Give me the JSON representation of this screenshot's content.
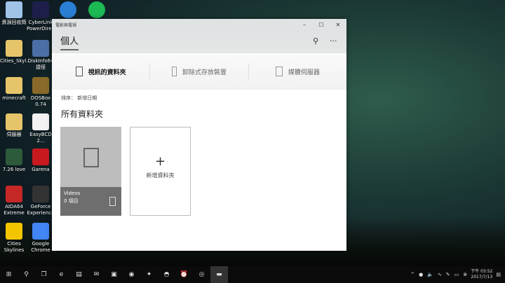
{
  "desktop": {
    "icons": [
      {
        "label": "資源回收筒",
        "color": "#9fc4e8"
      },
      {
        "label": "CyberLink PowerDire...",
        "color": "#1d1f4a"
      },
      {
        "label": "",
        "color": "#2a7fd4"
      },
      {
        "label": "",
        "color": "#1db954"
      },
      {
        "label": "Cities_Skyl...",
        "color": "#e6c56a"
      },
      {
        "label": "DiskInfo64 捷徑",
        "color": "#4d6fa8"
      },
      {
        "label": "minecraft",
        "color": "#e6c56a"
      },
      {
        "label": "DOSBox 0.74",
        "color": "#8a6a2a"
      },
      {
        "label": "伺服器",
        "color": "#e6c56a"
      },
      {
        "label": "EasyBCD 2...",
        "color": "#f2f2f2"
      },
      {
        "label": "7.26 love",
        "color": "#2c5a3a"
      },
      {
        "label": "Garena",
        "color": "#c8191f"
      },
      {
        "label": "AIDA64 Extreme",
        "color": "#c62828"
      },
      {
        "label": "GeForce Experience",
        "color": "#333333"
      },
      {
        "label": "Cities Skylines",
        "color": "#f2c500"
      },
      {
        "label": "Google Chrome",
        "color": "#4285f4"
      }
    ]
  },
  "window": {
    "title": "電影與電視",
    "controls": {
      "minimize": "–",
      "maximize": "☐",
      "close": "✕"
    },
    "tab": "個人",
    "search_icon": "⚲",
    "more_icon": "···",
    "pivots": [
      "視訊的資料夾",
      "卸除式存放裝置",
      "媒體伺服器"
    ],
    "sort": "排序：  新增日期",
    "section_title": "所有資料夾",
    "folder": {
      "name": "Videos",
      "count": "0 項目"
    },
    "add_folder": {
      "icon": "+",
      "label": "新增資料夾"
    }
  },
  "taskbar": {
    "start": "⊞",
    "search": "⚲",
    "taskview": "❐",
    "apps": [
      "e",
      "▤",
      "✉",
      "▣",
      "◉",
      "✦",
      "◓",
      "⏰",
      "◎",
      "▬"
    ],
    "tray": [
      "^",
      "●",
      "🔈",
      "∿",
      "✎",
      "▭",
      "⊗"
    ],
    "time": "下午 03:52",
    "date": "2017/7/13",
    "notif": "▤"
  }
}
